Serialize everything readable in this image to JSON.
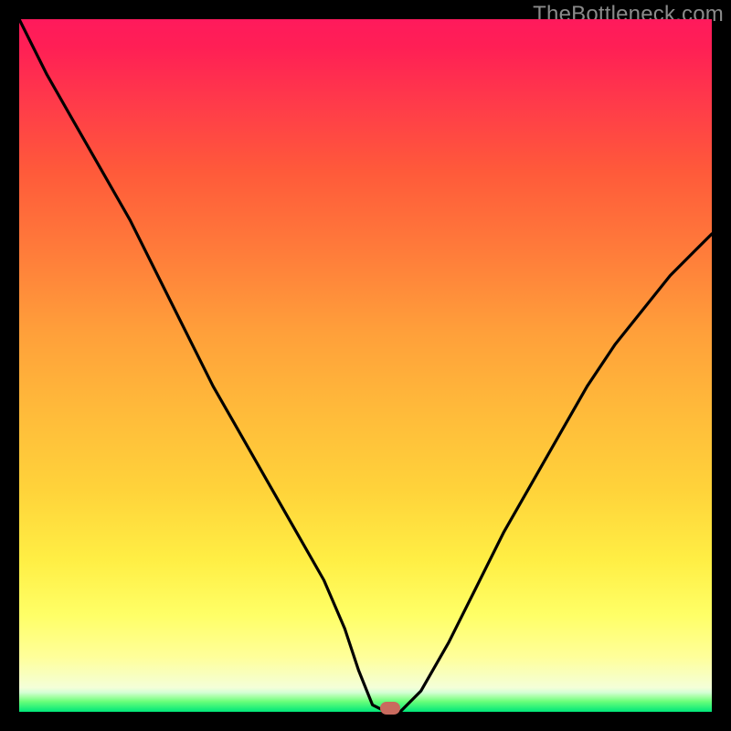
{
  "watermark": "TheBottleneck.com",
  "colors": {
    "frame": "#000000",
    "marker_fill": "#c96a5e",
    "curve_stroke": "#000000"
  },
  "chart_data": {
    "type": "line",
    "title": "",
    "xlabel": "",
    "ylabel": "",
    "xlim": [
      0,
      100
    ],
    "ylim": [
      0,
      100
    ],
    "grid": false,
    "annotations": [],
    "series": [
      {
        "name": "curve",
        "x": [
          0,
          4,
          8,
          12,
          16,
          20,
          24,
          28,
          32,
          36,
          40,
          44,
          47,
          49,
          51,
          53,
          55,
          58,
          62,
          66,
          70,
          74,
          78,
          82,
          86,
          90,
          94,
          98,
          100
        ],
        "values": [
          100,
          92,
          85,
          78,
          71,
          63,
          55,
          47,
          40,
          33,
          26,
          19,
          12,
          6,
          1,
          0,
          0,
          3,
          10,
          18,
          26,
          33,
          40,
          47,
          53,
          58,
          63,
          67,
          69
        ]
      }
    ],
    "marker": {
      "x": 53.5,
      "y": 0.5
    },
    "background_gradient": {
      "direction": "bottom-to-top",
      "stops": [
        {
          "pos": 0.0,
          "color": "#00e77a"
        },
        {
          "pos": 0.03,
          "color": "#d5ffd5"
        },
        {
          "pos": 0.1,
          "color": "#ffff80"
        },
        {
          "pos": 0.35,
          "color": "#ffcc3a"
        },
        {
          "pos": 0.6,
          "color": "#ff8c3a"
        },
        {
          "pos": 0.85,
          "color": "#ff4048"
        },
        {
          "pos": 1.0,
          "color": "#ff1a5c"
        }
      ]
    }
  }
}
